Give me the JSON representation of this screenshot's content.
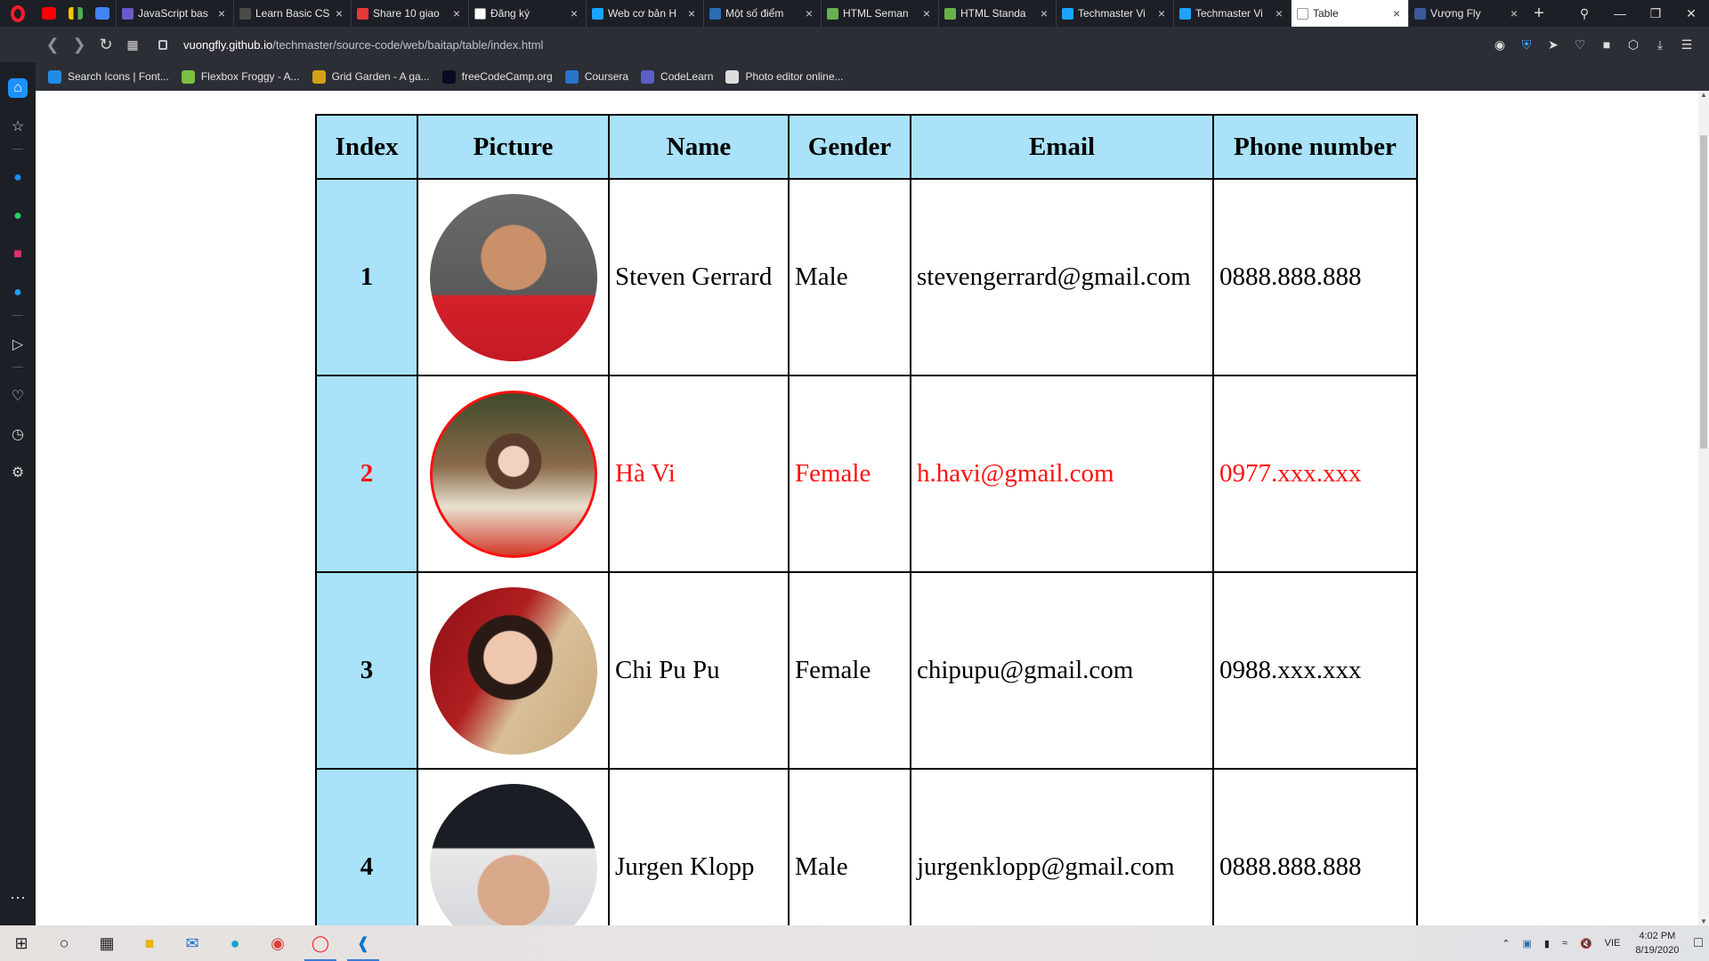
{
  "browser": {
    "tabs": [
      {
        "title": "JavaScript bas",
        "color": "#6a5acd"
      },
      {
        "title": "Learn Basic CS",
        "color": "#4b4b4b"
      },
      {
        "title": "Share 10 giao",
        "color": "#e53935"
      },
      {
        "title": "Đăng ký",
        "color": "#ffffff"
      },
      {
        "title": "Web cơ bản H",
        "color": "#1aa3ff"
      },
      {
        "title": "Một số điểm",
        "color": "#2b6cb0"
      },
      {
        "title": "HTML Seman",
        "color": "#6ab04c"
      },
      {
        "title": "HTML Standa",
        "color": "#6ab04c"
      },
      {
        "title": "Techmaster Vi",
        "color": "#1aa3ff"
      },
      {
        "title": "Techmaster Vi",
        "color": "#1aa3ff"
      },
      {
        "title": "Table",
        "color": "#ffffff",
        "active": true
      },
      {
        "title": "Vượng Fly",
        "color": "#3b5998"
      }
    ],
    "url_host": "vuongfly.github.io",
    "url_path": "/techmaster/source-code/web/baitap/table/index.html",
    "bookmarks": [
      {
        "label": "Search Icons | Font...",
        "color": "#228be6"
      },
      {
        "label": "Flexbox Froggy - A...",
        "color": "#7bc043"
      },
      {
        "label": "Grid Garden - A ga...",
        "color": "#d4a017"
      },
      {
        "label": "freeCodeCamp.org",
        "color": "#0a0a23"
      },
      {
        "label": "Coursera",
        "color": "#2a73cc"
      },
      {
        "label": "CodeLearn",
        "color": "#5b5fc7"
      },
      {
        "label": "Photo editor online...",
        "color": "#dddddd"
      }
    ]
  },
  "table": {
    "headers": [
      "Index",
      "Picture",
      "Name",
      "Gender",
      "Email",
      "Phone number"
    ],
    "rows": [
      {
        "index": "1",
        "name": "Steven Gerrard",
        "gender": "Male",
        "email": "stevengerrard@gmail.com",
        "phone": "0888.888.888",
        "highlight": false
      },
      {
        "index": "2",
        "name": "Hà Vi",
        "gender": "Female",
        "email": "h.havi@gmail.com",
        "phone": "0977.xxx.xxx",
        "highlight": true
      },
      {
        "index": "3",
        "name": "Chi Pu Pu",
        "gender": "Female",
        "email": "chipupu@gmail.com",
        "phone": "0988.xxx.xxx",
        "highlight": false
      },
      {
        "index": "4",
        "name": "Jurgen Klopp",
        "gender": "Male",
        "email": "jurgenklopp@gmail.com",
        "phone": "0888.888.888",
        "highlight": false
      }
    ],
    "colors": {
      "header_bg": "#a9e2f9",
      "highlight_text": "#ff1010"
    }
  },
  "taskbar": {
    "lang": "VIE",
    "time": "4:02 PM",
    "date": "8/19/2020"
  }
}
